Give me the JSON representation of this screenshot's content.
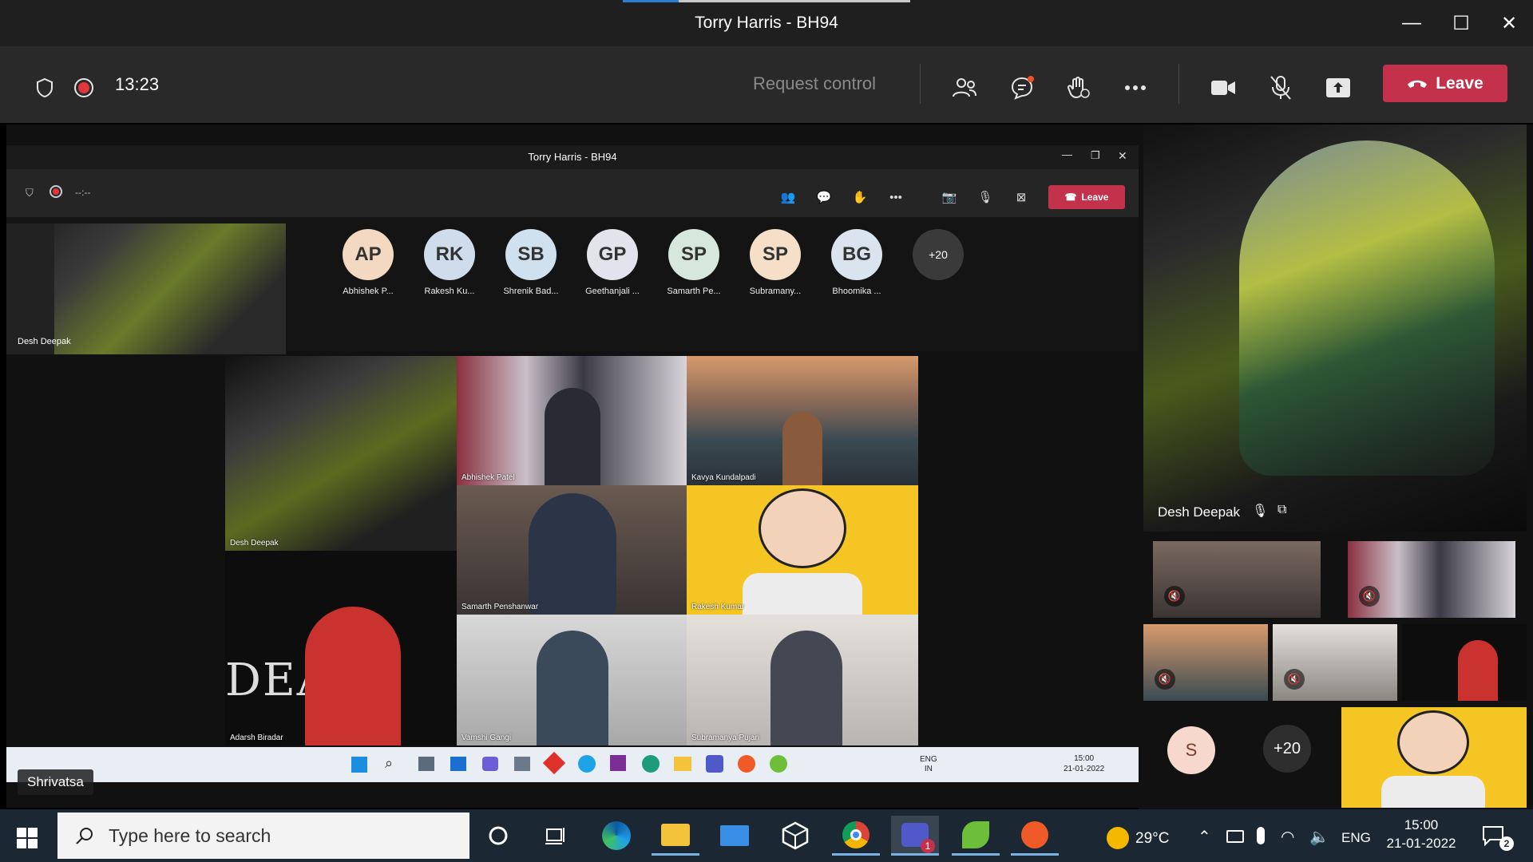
{
  "window": {
    "title": "Torry Harris - BH94",
    "minimize_glyph": "—",
    "maximize_glyph": "☐",
    "close_glyph": "✕"
  },
  "meeting_toolbar": {
    "timer": "13:23",
    "request_control": "Request control",
    "leave_label": "Leave"
  },
  "shared_screen": {
    "title": "Torry Harris - BH94",
    "timer": "--:--",
    "leave_label": "Leave",
    "mini_video_label": "Desh Deepak",
    "self_avatar_initial": "S",
    "participants": [
      {
        "initials": "AP",
        "name": "Abhishek P...",
        "color": "#f4d9c2"
      },
      {
        "initials": "RK",
        "name": "Rakesh Ku...",
        "color": "#cfdcec"
      },
      {
        "initials": "SB",
        "name": "Shrenik Bad...",
        "color": "#cfe1ee"
      },
      {
        "initials": "GP",
        "name": "Geethanjali ...",
        "color": "#e3e3ee"
      },
      {
        "initials": "SP",
        "name": "Samarth Pe...",
        "color": "#d6e8dd"
      },
      {
        "initials": "SP",
        "name": "Subramany...",
        "color": "#f6dfc8"
      },
      {
        "initials": "BG",
        "name": "Bhoomika ...",
        "color": "#d9e4ee"
      }
    ],
    "overflow_count": "+20",
    "gallery": [
      {
        "name": "Desh Deepak"
      },
      {
        "name": "Abhishek Patel"
      },
      {
        "name": "Kavya Kundalpadi"
      },
      {
        "name": "Samarth Penshanwar"
      },
      {
        "name": "Rakesh Kumar"
      },
      {
        "name": "Adarsh Biradar"
      },
      {
        "name": "Vamshi Gangi"
      },
      {
        "name": "Subramanya Pujari"
      }
    ],
    "inner_tray": {
      "lang_top": "ENG",
      "lang_bottom": "IN",
      "time": "15:00",
      "date": "21-01-2022"
    },
    "presenter_label": "Shrivatsa"
  },
  "right_pane": {
    "main_speaker": "Desh Deepak",
    "self_initial": "S",
    "overflow_count": "+20"
  },
  "taskbar": {
    "search_placeholder": "Type here to search",
    "teams_badge": "1",
    "weather": "29°C",
    "language": "ENG",
    "time": "15:00",
    "date": "21-01-2022",
    "notification_count": "2"
  }
}
